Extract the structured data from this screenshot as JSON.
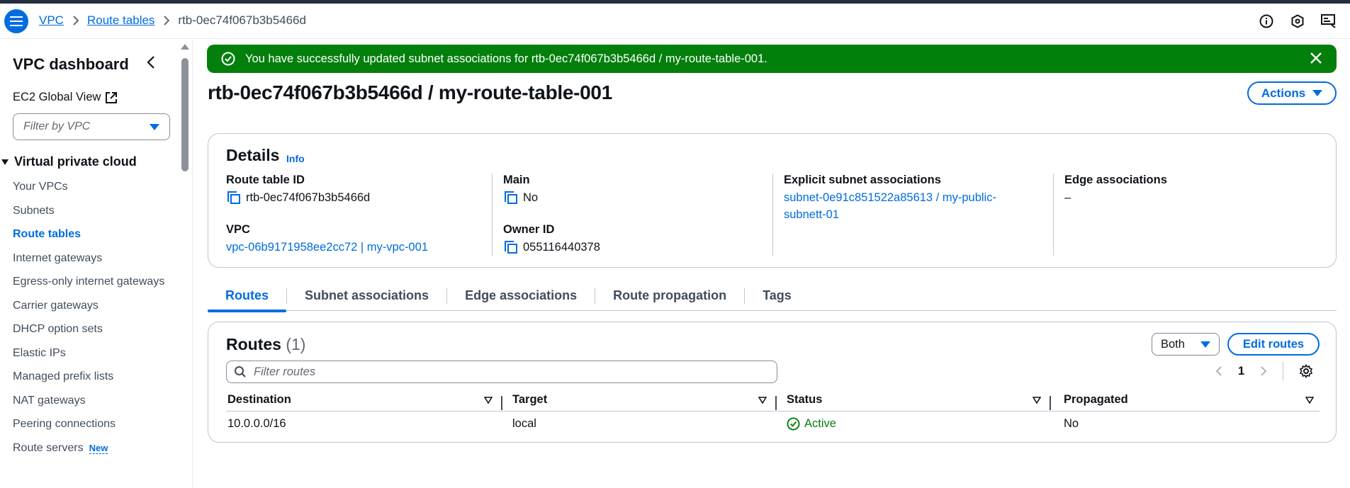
{
  "breadcrumb": {
    "items": [
      "VPC",
      "Route tables"
    ],
    "current": "rtb-0ec74f067b3b5466d"
  },
  "sidebar": {
    "title": "VPC dashboard",
    "ec2_global_view": "EC2 Global View",
    "filter_placeholder": "Filter by VPC",
    "section": "Virtual private cloud",
    "items": [
      {
        "label": "Your VPCs"
      },
      {
        "label": "Subnets"
      },
      {
        "label": "Route tables",
        "active": true
      },
      {
        "label": "Internet gateways"
      },
      {
        "label": "Egress-only internet gateways"
      },
      {
        "label": "Carrier gateways"
      },
      {
        "label": "DHCP option sets"
      },
      {
        "label": "Elastic IPs"
      },
      {
        "label": "Managed prefix lists"
      },
      {
        "label": "NAT gateways"
      },
      {
        "label": "Peering connections"
      },
      {
        "label": "Route servers",
        "badge": "New"
      }
    ]
  },
  "flash": {
    "message": "You have successfully updated subnet associations for rtb-0ec74f067b3b5466d / my-route-table-001."
  },
  "page": {
    "title": "rtb-0ec74f067b3b5466d / my-route-table-001",
    "actions_label": "Actions"
  },
  "details": {
    "heading": "Details",
    "info": "Info",
    "route_table_id_label": "Route table ID",
    "route_table_id": "rtb-0ec74f067b3b5466d",
    "vpc_label": "VPC",
    "vpc": "vpc-06b9171958ee2cc72 | my-vpc-001",
    "main_label": "Main",
    "main": "No",
    "owner_id_label": "Owner ID",
    "owner_id": "055116440378",
    "explicit_label": "Explicit subnet associations",
    "explicit_line1": "subnet-0e91c851522a85613 / my-public-",
    "explicit_line2": "subnett-01",
    "edge_label": "Edge associations",
    "edge": "–"
  },
  "tabs": [
    "Routes",
    "Subnet associations",
    "Edge associations",
    "Route propagation",
    "Tags"
  ],
  "routes": {
    "heading": "Routes",
    "count": "(1)",
    "both_label": "Both",
    "edit_label": "Edit routes",
    "filter_placeholder": "Filter routes",
    "page_number": "1",
    "columns": [
      "Destination",
      "Target",
      "Status",
      "Propagated"
    ],
    "rows": [
      {
        "destination": "10.0.0.0/16",
        "target": "local",
        "status": "Active",
        "propagated": "No"
      }
    ]
  },
  "colors": {
    "accent": "#006ce0",
    "success": "#037f0c",
    "topbar": "#232f3e"
  }
}
